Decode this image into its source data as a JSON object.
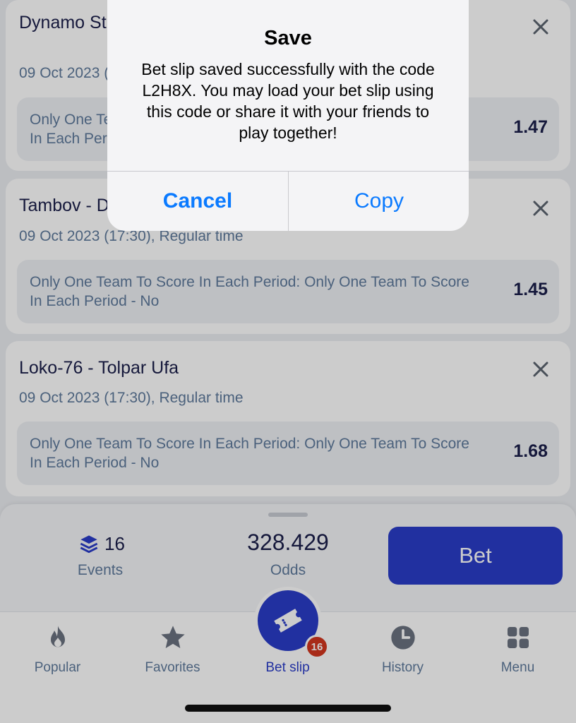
{
  "bet_slip_items": [
    {
      "match": "Dynamo St. Petersburg - Verkhnyaya Pyshma",
      "date_line": "09 Oct 2023 (17:30), Regular time",
      "pick": "Only One Team To Score In Each Period: Only One Team To Score In Each Period - No",
      "odd": "1.47"
    },
    {
      "match": "Tambov - Dynamo Moscow",
      "date_line": "09 Oct 2023 (17:30), Regular time",
      "pick": "Only One Team To Score In Each Period: Only One Team To Score In Each Period - No",
      "odd": "1.45"
    },
    {
      "match": "Loko-76 - Tolpar Ufa",
      "date_line": "09 Oct 2023 (17:30), Regular time",
      "pick": "Only One Team To Score In Each Period: Only One Team To Score In Each Period - No",
      "odd": "1.68"
    }
  ],
  "summary": {
    "events_count": "16",
    "events_label": "Events",
    "odds_value": "328.429",
    "odds_label": "Odds",
    "bet_label": "Bet"
  },
  "tabbar": {
    "items": [
      {
        "label": "Popular",
        "icon": "flame-icon"
      },
      {
        "label": "Favorites",
        "icon": "star-icon"
      },
      {
        "label": "Bet slip",
        "icon": "ticket-icon",
        "badge": "16"
      },
      {
        "label": "History",
        "icon": "clock-icon"
      },
      {
        "label": "Menu",
        "icon": "grid-icon"
      }
    ]
  },
  "alert": {
    "title": "Save",
    "message": "Bet slip saved successfully with the code L2H8X. You may load your bet slip using this code or share it with your friends to play together!",
    "cancel_label": "Cancel",
    "copy_label": "Copy"
  },
  "colors": {
    "accent": "#2a3cc9",
    "ios_link": "#0a7aff",
    "badge": "#d2361f",
    "muted_text": "#5e7a9c"
  }
}
